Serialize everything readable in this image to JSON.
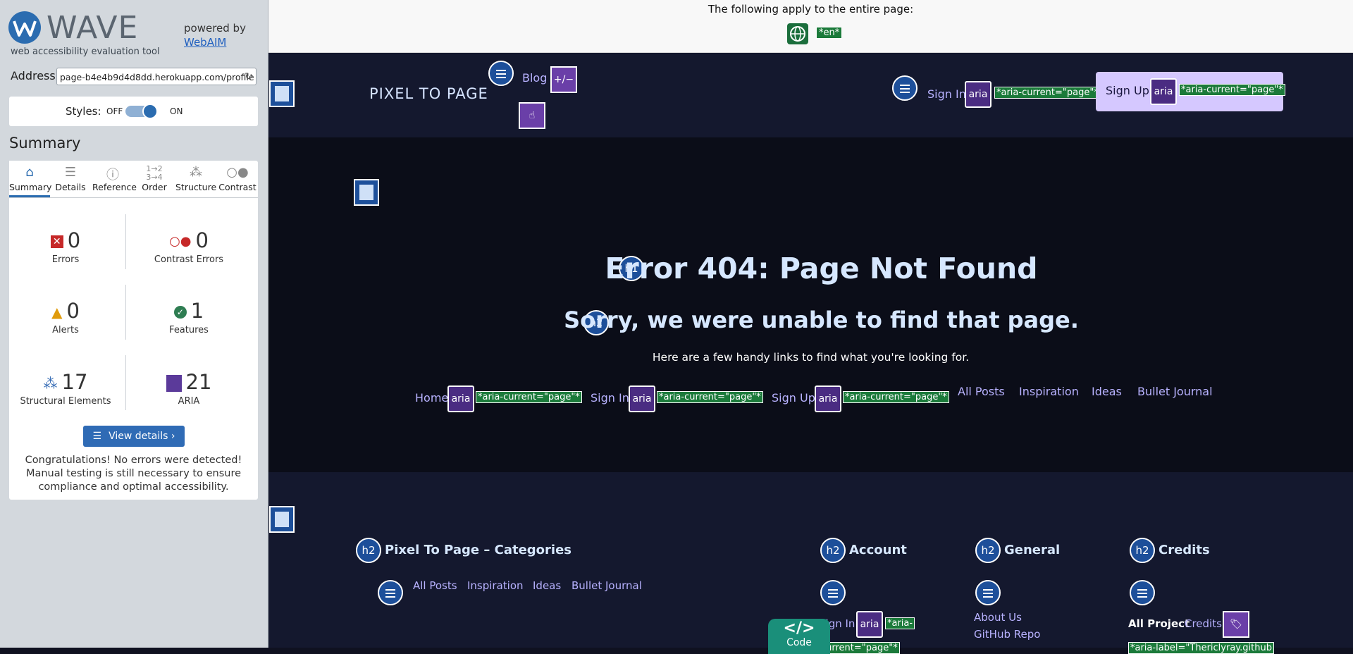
{
  "wave": {
    "title": "WAVE",
    "subtitle": "web accessibility evaluation tool",
    "powered_by": "powered by",
    "webaim": "WebAIM",
    "address_label": "Address:",
    "address_value": "page-b4e4b9d4d8dd.herokuapp.com/profile",
    "styles_label": "Styles:",
    "styles_off": "OFF",
    "styles_on": "ON",
    "summary_heading": "Summary",
    "tabs": [
      {
        "label": "Summary",
        "icon": "home-icon"
      },
      {
        "label": "Details",
        "icon": "list-icon"
      },
      {
        "label": "Reference",
        "icon": "info-icon"
      },
      {
        "label": "Order",
        "icon": "order-icon"
      },
      {
        "label": "Structure",
        "icon": "structure-icon"
      },
      {
        "label": "Contrast",
        "icon": "contrast-icon"
      }
    ],
    "stats": {
      "errors": {
        "count": "0",
        "label": "Errors"
      },
      "contrast_errors": {
        "count": "0",
        "label": "Contrast Errors"
      },
      "alerts": {
        "count": "0",
        "label": "Alerts"
      },
      "features": {
        "count": "1",
        "label": "Features"
      },
      "structural": {
        "count": "17",
        "label": "Structural Elements"
      },
      "aria": {
        "count": "21",
        "label": "ARIA"
      }
    },
    "view_details": "View details ›",
    "congrats": "Congratulations! No errors were detected! Manual testing is still necessary to ensure compliance and optimal accessibility."
  },
  "page": {
    "top_notice": "The following apply to the entire page:",
    "lang_tag": "*en*",
    "nav": {
      "brand": "PIXEL TO PAGE",
      "blog": "Blog",
      "toggle_badge": "+/−",
      "sign_in": "Sign In",
      "sign_up": "Sign Up",
      "aria_badge": "aria",
      "aria_current": "*aria-current=\"page\"*"
    },
    "main": {
      "h1_badge": "h1",
      "h1": "Error 404: Page Not Found",
      "h2_badge": "h2",
      "h2": "Sorry, we were unable to find that page.",
      "hint": "Here are a few handy links to find what you're looking for.",
      "links": {
        "home": "Home",
        "sign_in": "Sign In",
        "sign_up": "Sign Up",
        "all_posts": "All Posts",
        "inspiration": "Inspiration",
        "ideas": "Ideas",
        "bullet_journal": "Bullet Journal"
      }
    },
    "footer": {
      "categories_heading": "Pixel To Page – Categories",
      "account_heading": "Account",
      "general_heading": "General",
      "credits_heading": "Credits",
      "all_posts": "All Posts",
      "inspiration": "Inspiration",
      "ideas": "Ideas",
      "bullet_journal": "Bullet Journal",
      "sign_in": "Sign In",
      "aria_partial": "*aria-",
      "aria_partial2": "current=\"page\"*",
      "about_us": "About Us",
      "github_repo": "GitHub Repo",
      "all_project": "All Project",
      "credits_link": "Credits",
      "aria_label_partial": "*aria-label=\"Thericlyray.github",
      "code_label": "Code",
      "code_glyph": "</>"
    }
  }
}
